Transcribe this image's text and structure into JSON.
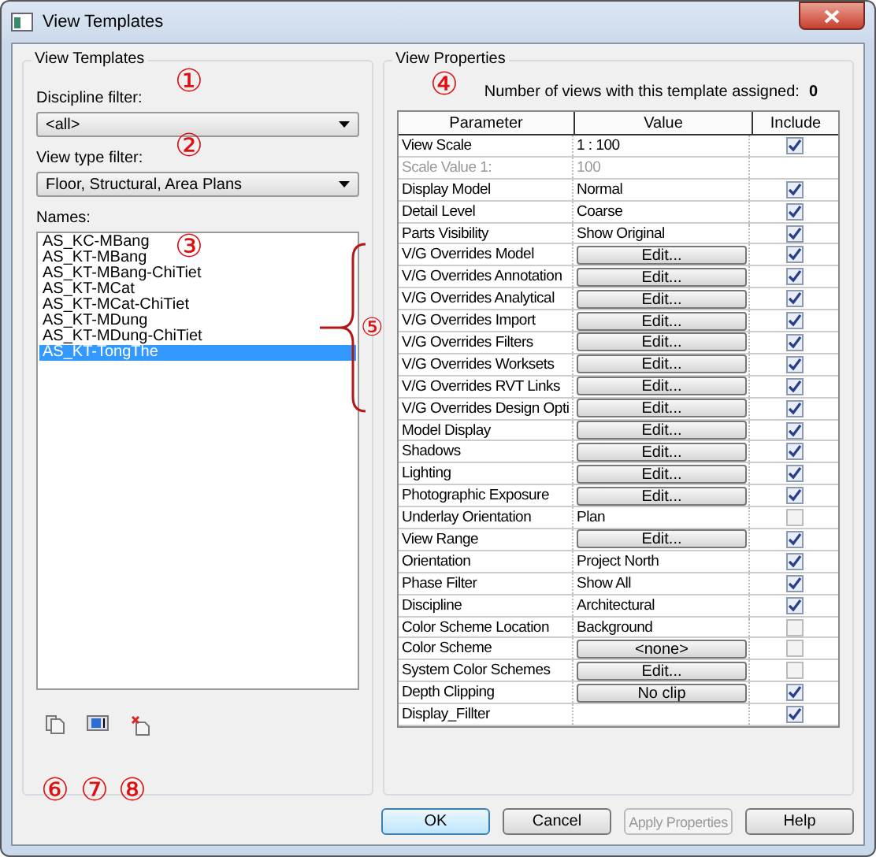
{
  "window": {
    "title": "View Templates"
  },
  "templates_panel": {
    "title": "View Templates",
    "discipline_label": "Discipline filter:",
    "discipline_value": "<all>",
    "type_label": "View type filter:",
    "type_value": "Floor, Structural, Area Plans",
    "names_label": "Names:",
    "names": [
      {
        "label": "AS_KC-MBang",
        "selected": false
      },
      {
        "label": "AS_KT-MBang",
        "selected": false
      },
      {
        "label": "AS_KT-MBang-ChiTiet",
        "selected": false
      },
      {
        "label": "AS_KT-MCat",
        "selected": false
      },
      {
        "label": "AS_KT-MCat-ChiTiet",
        "selected": false
      },
      {
        "label": "AS_KT-MDung",
        "selected": false
      },
      {
        "label": "AS_KT-MDung-ChiTiet",
        "selected": false
      },
      {
        "label": "AS_KT-TongThe",
        "selected": true
      }
    ]
  },
  "properties_panel": {
    "title": "View Properties",
    "count_label": "Number of views with this template assigned:",
    "count": "0",
    "columns": [
      "Parameter",
      "Value",
      "Include"
    ],
    "rows": [
      {
        "parameter": "View Scale",
        "kind": "text",
        "value": " 1 : 100",
        "disabled": false,
        "include": true
      },
      {
        "parameter": "Scale Value    1:",
        "kind": "text",
        "value": "100",
        "disabled": true
      },
      {
        "parameter": "Display Model",
        "kind": "text",
        "value": "Normal",
        "disabled": false,
        "include": true
      },
      {
        "parameter": "Detail Level",
        "kind": "text",
        "value": "Coarse",
        "disabled": false,
        "include": true
      },
      {
        "parameter": "Parts Visibility",
        "kind": "text",
        "value": "Show Original",
        "disabled": false,
        "include": true
      },
      {
        "parameter": "V/G Overrides Model",
        "kind": "button",
        "value": "Edit...",
        "disabled": false,
        "include": true
      },
      {
        "parameter": "V/G Overrides Annotation",
        "kind": "button",
        "value": "Edit...",
        "disabled": false,
        "include": true
      },
      {
        "parameter": "V/G Overrides Analytical",
        "kind": "button",
        "value": "Edit...",
        "disabled": false,
        "include": true
      },
      {
        "parameter": "V/G Overrides Import",
        "kind": "button",
        "value": "Edit...",
        "disabled": false,
        "include": true
      },
      {
        "parameter": "V/G Overrides Filters",
        "kind": "button",
        "value": "Edit...",
        "disabled": false,
        "include": true
      },
      {
        "parameter": "V/G Overrides Worksets",
        "kind": "button",
        "value": "Edit...",
        "disabled": false,
        "include": true
      },
      {
        "parameter": "V/G Overrides RVT Links",
        "kind": "button",
        "value": "Edit...",
        "disabled": false,
        "include": true
      },
      {
        "parameter": "V/G Overrides Design Opti",
        "kind": "button",
        "value": "Edit...",
        "disabled": false,
        "include": true
      },
      {
        "parameter": "Model Display",
        "kind": "button",
        "value": "Edit...",
        "disabled": false,
        "include": true
      },
      {
        "parameter": "Shadows",
        "kind": "button",
        "value": "Edit...",
        "disabled": false,
        "include": true
      },
      {
        "parameter": "Lighting",
        "kind": "button",
        "value": "Edit...",
        "disabled": false,
        "include": true
      },
      {
        "parameter": "Photographic Exposure",
        "kind": "button",
        "value": "Edit...",
        "disabled": false,
        "include": true
      },
      {
        "parameter": "Underlay Orientation",
        "kind": "text",
        "value": "Plan",
        "disabled": false,
        "include": false
      },
      {
        "parameter": "View Range",
        "kind": "button",
        "value": "Edit...",
        "disabled": false,
        "include": true
      },
      {
        "parameter": "Orientation",
        "kind": "text",
        "value": "Project North",
        "disabled": false,
        "include": true
      },
      {
        "parameter": "Phase Filter",
        "kind": "text",
        "value": "Show All",
        "disabled": false,
        "include": true
      },
      {
        "parameter": "Discipline",
        "kind": "text",
        "value": "Architectural",
        "disabled": false,
        "include": true
      },
      {
        "parameter": "Color Scheme Location",
        "kind": "text",
        "value": "Background",
        "disabled": false,
        "include": false
      },
      {
        "parameter": "Color Scheme",
        "kind": "button",
        "value": "<none>",
        "disabled": false,
        "include": false
      },
      {
        "parameter": "System Color Schemes",
        "kind": "button",
        "value": "Edit...",
        "disabled": false,
        "include": false
      },
      {
        "parameter": "Depth Clipping",
        "kind": "button",
        "value": "No clip",
        "disabled": false,
        "include": true
      },
      {
        "parameter": "Display_Fillter",
        "kind": "text",
        "value": "",
        "disabled": false,
        "include": true
      }
    ]
  },
  "buttons": [
    {
      "label": "OK",
      "disabled": false
    },
    {
      "label": "Cancel",
      "disabled": false
    },
    {
      "label": "Apply Properties",
      "disabled": true
    },
    {
      "label": "Help",
      "disabled": false
    }
  ],
  "annotations": [
    "①",
    "②",
    "③",
    "④",
    "⑤",
    "⑥",
    "⑦",
    "⑧"
  ]
}
